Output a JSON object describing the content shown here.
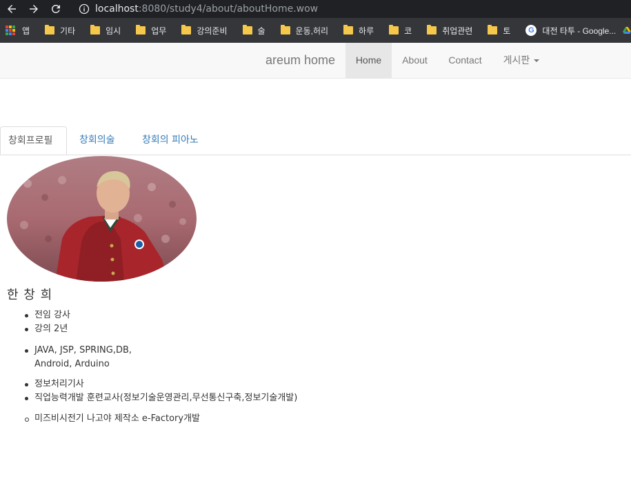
{
  "browser": {
    "url_host": "localhost",
    "url_rest": ":8080/study4/about/aboutHome.wow",
    "bookmarks": [
      {
        "label": "앱",
        "type": "apps"
      },
      {
        "label": "기타",
        "type": "folder"
      },
      {
        "label": "임시",
        "type": "folder"
      },
      {
        "label": "업무",
        "type": "folder"
      },
      {
        "label": "강의준비",
        "type": "folder"
      },
      {
        "label": "술",
        "type": "folder"
      },
      {
        "label": "운동,허리",
        "type": "folder"
      },
      {
        "label": "하루",
        "type": "folder"
      },
      {
        "label": "코",
        "type": "folder"
      },
      {
        "label": "취업관련",
        "type": "folder"
      },
      {
        "label": "토",
        "type": "folder"
      },
      {
        "label": "대전 타투 - Google...",
        "type": "google"
      }
    ]
  },
  "navbar": {
    "brand": "areum home",
    "items": [
      {
        "label": "Home",
        "active": true
      },
      {
        "label": "About",
        "active": false
      },
      {
        "label": "Contact",
        "active": false
      },
      {
        "label": "게시판",
        "active": false,
        "dropdown": true
      }
    ]
  },
  "tabs": [
    {
      "label": "창회프로필",
      "active": true
    },
    {
      "label": "창회의술",
      "active": false
    },
    {
      "label": "창회의 피아노",
      "active": false
    }
  ],
  "profile": {
    "name": "한 창 희",
    "list1": [
      "전임 강사",
      "강의 2년"
    ],
    "list2_line1": "JAVA, JSP, SPRING,DB,",
    "list2_line2": "Android, Arduino",
    "list3": [
      "정보처리기사",
      "직업능력개발 훈련교사(정보기술운영관리,무선통신구축,정보기술개발)"
    ],
    "list4": [
      "미즈비시전기 나고야 제작소 e-Factory개발"
    ]
  }
}
